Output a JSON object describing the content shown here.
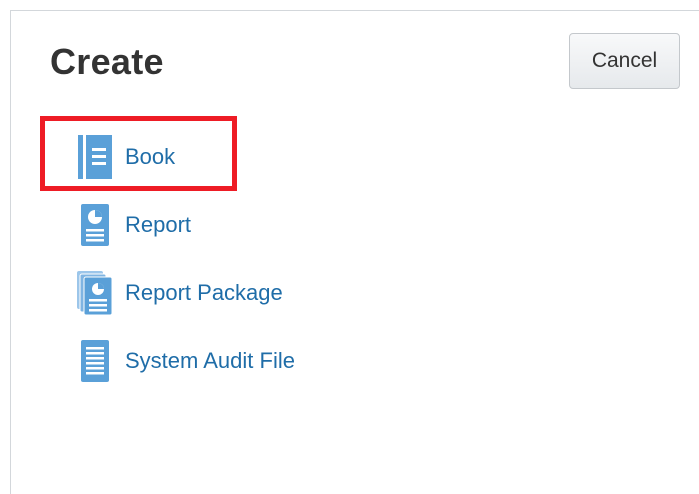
{
  "dialog": {
    "title": "Create",
    "cancel_label": "Cancel"
  },
  "menu": {
    "items": [
      {
        "label": "Book",
        "icon": "book-icon"
      },
      {
        "label": "Report",
        "icon": "report-icon"
      },
      {
        "label": "Report Package",
        "icon": "report-package-icon"
      },
      {
        "label": "System Audit File",
        "icon": "audit-file-icon"
      }
    ]
  },
  "colors": {
    "icon_blue": "#5aa0d8",
    "link_blue": "#1f6da8",
    "highlight_red": "#ee1c25"
  }
}
